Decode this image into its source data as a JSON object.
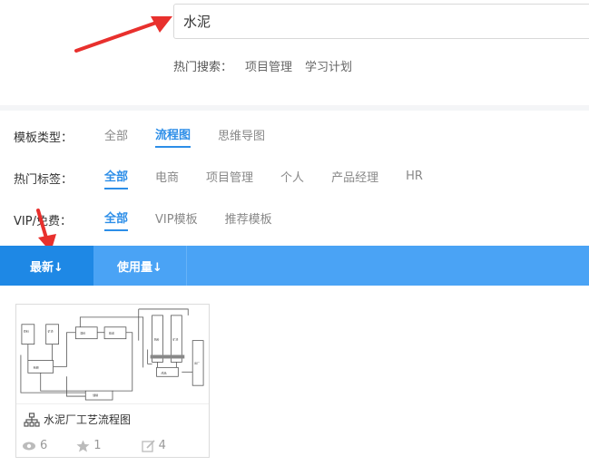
{
  "search": {
    "value": "水泥"
  },
  "hot_search": {
    "label": "热门搜索：",
    "links": [
      "项目管理",
      "学习计划"
    ]
  },
  "filters": {
    "template_type": {
      "label": "模板类型：",
      "options": [
        "全部",
        "流程图",
        "思维导图"
      ],
      "active": 1
    },
    "hot_tags": {
      "label": "热门标签：",
      "options": [
        "全部",
        "电商",
        "项目管理",
        "个人",
        "产品经理",
        "HR"
      ],
      "active": 0
    },
    "vip_free": {
      "label": "VIP/免费：",
      "options": [
        "全部",
        "VIP模板",
        "推荐模板"
      ],
      "active": 0
    }
  },
  "sort": {
    "newest": "最新↓",
    "usage": "使用量↓"
  },
  "card": {
    "title": "水泥厂工艺流程图",
    "views": "6",
    "stars": "1",
    "edits": "4"
  },
  "colors": {
    "accent": "#2c8ee8",
    "sortbar": "#4aa3f5",
    "sortbar_active": "#1e88e5",
    "annotation_arrow": "#e8302d"
  }
}
